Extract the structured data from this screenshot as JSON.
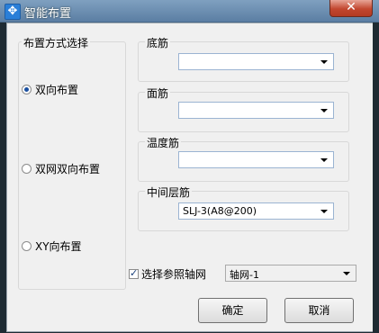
{
  "window": {
    "title": "智能布置",
    "close_label": "✕"
  },
  "layout_group": {
    "label": "布置方式选择",
    "options": [
      {
        "label": "双向布置",
        "checked": true
      },
      {
        "label": "双网双向布置",
        "checked": false
      },
      {
        "label": "XY向布置",
        "checked": false
      }
    ]
  },
  "fields": {
    "bottom": {
      "label": "底筋",
      "value": ""
    },
    "top": {
      "label": "面筋",
      "value": ""
    },
    "temperature": {
      "label": "温度筋",
      "value": ""
    },
    "middle": {
      "label": "中间层筋",
      "value": "SLJ-3(A8@200)"
    }
  },
  "axis": {
    "checkbox_label": "选择参照轴网",
    "checked": true,
    "selected": "轴网-1"
  },
  "buttons": {
    "ok": "确定",
    "cancel": "取消"
  }
}
